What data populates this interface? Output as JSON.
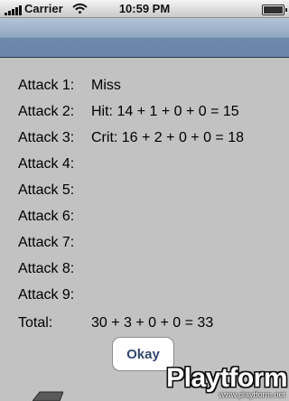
{
  "status_bar": {
    "carrier": "Carrier",
    "time": "10:59 PM",
    "icons": [
      "signal-bars-icon",
      "wifi-icon",
      "battery-icon"
    ]
  },
  "results": {
    "rows": [
      {
        "label": "Attack 1:",
        "value": "Miss"
      },
      {
        "label": "Attack 2:",
        "value": "Hit: 14 + 1 + 0 + 0 = 15"
      },
      {
        "label": "Attack 3:",
        "value": "Crit: 16 + 2 + 0 + 0 = 18"
      },
      {
        "label": "Attack 4:",
        "value": ""
      },
      {
        "label": "Attack 5:",
        "value": ""
      },
      {
        "label": "Attack 6:",
        "value": ""
      },
      {
        "label": "Attack 7:",
        "value": ""
      },
      {
        "label": "Attack 8:",
        "value": ""
      },
      {
        "label": "Attack 9:",
        "value": ""
      }
    ],
    "total": {
      "label": "Total:",
      "value": "30 + 3 + 0 + 0 = 33"
    }
  },
  "okay_button": {
    "label": "Okay"
  },
  "watermark": {
    "logo": "Playtform",
    "url": "www.playtform.net"
  },
  "colors": {
    "background": "#c2c2c2",
    "nav_bar": "#7d97b7",
    "button_text": "#32476e"
  }
}
